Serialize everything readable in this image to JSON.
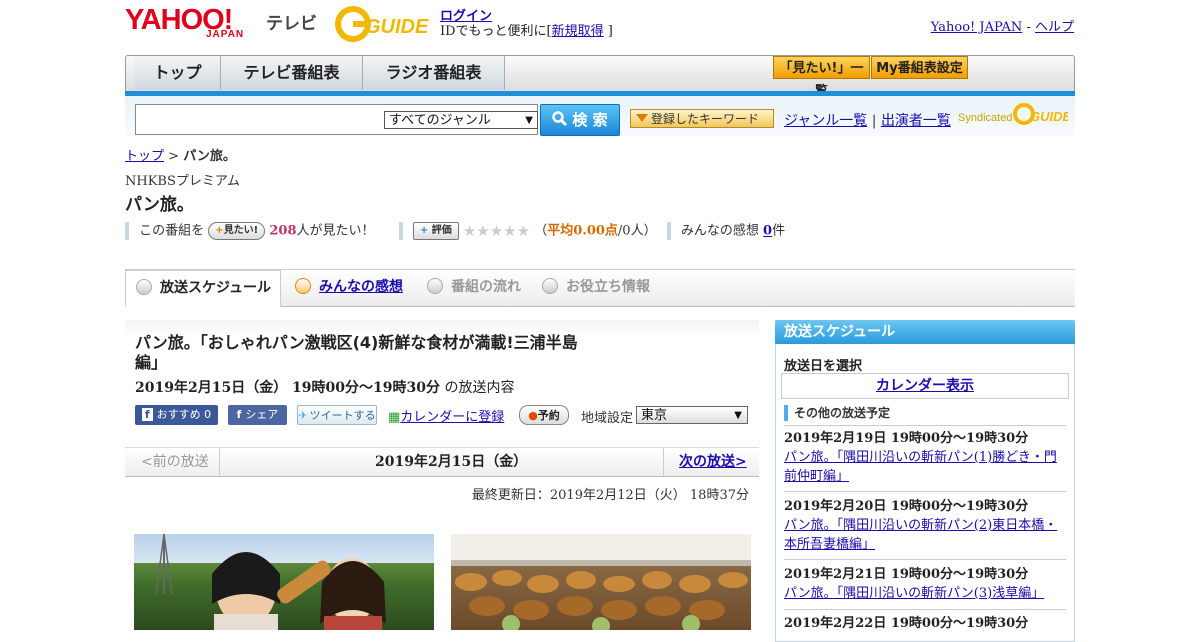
{
  "header": {
    "logo_yahoo": "YAHOO!",
    "logo_japan": "JAPAN",
    "logo_tv": "テレビ",
    "logo_guide": "GUIDE",
    "login_link": "ログイン",
    "login_sub_prefix": "IDでもっと便利に[",
    "register_link": "新規取得",
    "login_sub_suffix": "]",
    "yahoo_japan_link": "Yahoo! JAPAN",
    "separator": " - ",
    "help_link": "ヘルプ"
  },
  "nav": {
    "tabs": [
      {
        "label": "トップ"
      },
      {
        "label": "テレビ番組表"
      },
      {
        "label": "ラジオ番組表"
      }
    ],
    "want_list_button": "「見たい!」一覧",
    "my_schedule_button": "My番組表設定"
  },
  "search": {
    "input_value": "",
    "genre_selected": "すべてのジャンル",
    "search_button": "検 索",
    "keyword_button": "登録したキーワード",
    "genre_list_link": "ジャンル一覧",
    "pipe": "|",
    "performer_list_link": "出演者一覧",
    "syndicated_label": "Syndicated",
    "syndicated_guide": "GUIDE"
  },
  "breadcrumb": {
    "top": "トップ",
    "sep": " > ",
    "current": "パン旅。"
  },
  "program": {
    "channel": "NHKBSプレミアム",
    "title": "パン旅。",
    "want_prefix": "この番組を",
    "want_button": "見たい!",
    "want_count": "208",
    "want_suffix": "人が見たい！",
    "rate_button": "評価",
    "stars": "★★★★★",
    "avg_open": "（",
    "avg_label": "平均0.00点",
    "avg_count": "/0人",
    "avg_close": "）",
    "impressions_label": "みんなの感想",
    "impressions_count": "0",
    "impressions_suffix": "件"
  },
  "content_tabs": [
    {
      "label": "放送スケジュール"
    },
    {
      "label": "みんなの感想"
    },
    {
      "label": "番組の流れ"
    },
    {
      "label": "お役立ち情報"
    }
  ],
  "episode": {
    "title": "パン旅。「おしゃれパン激戦区(4)新鮮な食材が満載!三浦半島編」",
    "date": "2019年2月15日（金） 19時00分～19時30分",
    "date_suffix": "の放送内容",
    "fb_recommend": "おすすめ 0",
    "fb_share": "シェア",
    "tweet": "ツイートする",
    "calendar_register": "カレンダーに登録",
    "reserve": "予約",
    "region_label": "地域設定",
    "region_value": "東京"
  },
  "pager": {
    "prev": "<前の放送",
    "current": "2019年2月15日（金）",
    "next": "次の放送>"
  },
  "updated": "最終更新日：2019年2月12日（火） 18時37分",
  "sidebar": {
    "heading": "放送スケジュール",
    "select_label": "放送日を選択",
    "calendar_button": "カレンダー表示",
    "other_heading": "その他の放送予定",
    "items": [
      {
        "date": "2019年2月19日 19時00分～19時30分",
        "title": "パン旅。「隅田川沿いの斬新パン(1)勝どき・門前仲町編」"
      },
      {
        "date": "2019年2月20日 19時00分～19時30分",
        "title": "パン旅。「隅田川沿いの斬新パン(2)東日本橋・本所吾妻橋編」"
      },
      {
        "date": "2019年2月21日 19時00分～19時30分",
        "title": "パン旅。「隅田川沿いの斬新パン(3)浅草編」"
      },
      {
        "date": "2019年2月22日 19時00分～19時30分",
        "title": ""
      }
    ]
  }
}
